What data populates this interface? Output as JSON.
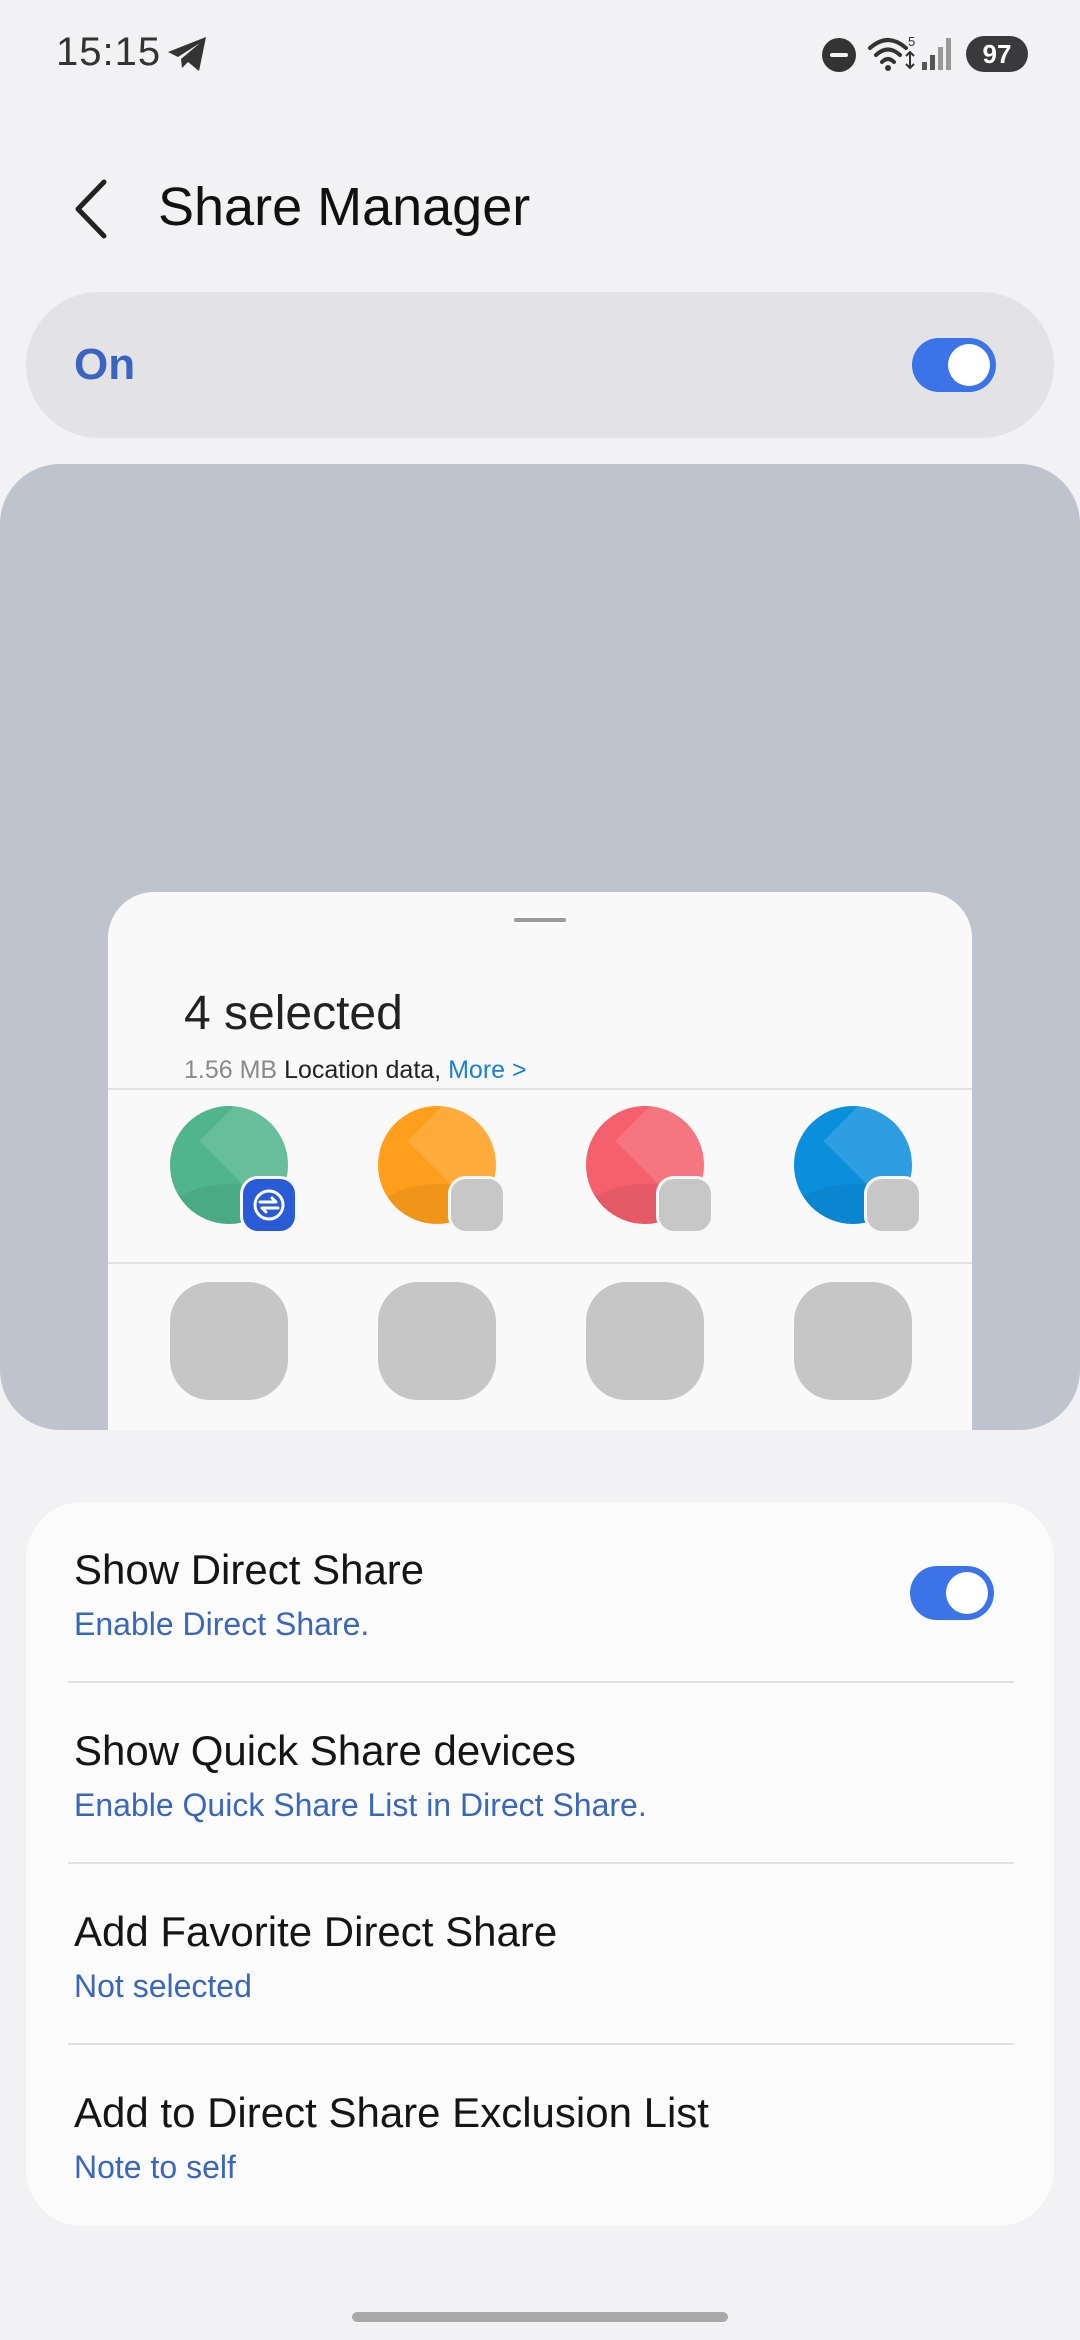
{
  "status_bar": {
    "time": "15:15",
    "battery": "97",
    "wifi_badge": "5",
    "icons": [
      "telegram-icon",
      "dnd-icon",
      "wifi-icon",
      "signal-icon"
    ]
  },
  "header": {
    "title": "Share Manager",
    "back_icon": "chevron-left-icon"
  },
  "master": {
    "label": "On",
    "enabled": true
  },
  "preview": {
    "title": "4 selected",
    "size": "1.56 MB",
    "location": "Location data,",
    "more": "More >",
    "apps": [
      {
        "color": "#4fb58a",
        "badge": "quickshare"
      },
      {
        "color": "#ff9f1c",
        "badge": "placeholder"
      },
      {
        "color": "#f4606c",
        "badge": "placeholder"
      },
      {
        "color": "#0b8fdd",
        "badge": "placeholder"
      }
    ]
  },
  "settings": {
    "items": [
      {
        "title": "Show Direct Share",
        "subtitle": "Enable Direct Share.",
        "toggle": true
      },
      {
        "title": "Show Quick Share devices",
        "subtitle": "Enable Quick Share List in Direct Share.",
        "toggle": false
      },
      {
        "title": "Add Favorite Direct Share",
        "subtitle": "Not selected",
        "toggle": false
      },
      {
        "title": "Add to Direct Share Exclusion List",
        "subtitle": "Note to self",
        "toggle": false
      }
    ]
  },
  "colors": {
    "accent": "#3a74e8",
    "link": "#3a67b8"
  }
}
